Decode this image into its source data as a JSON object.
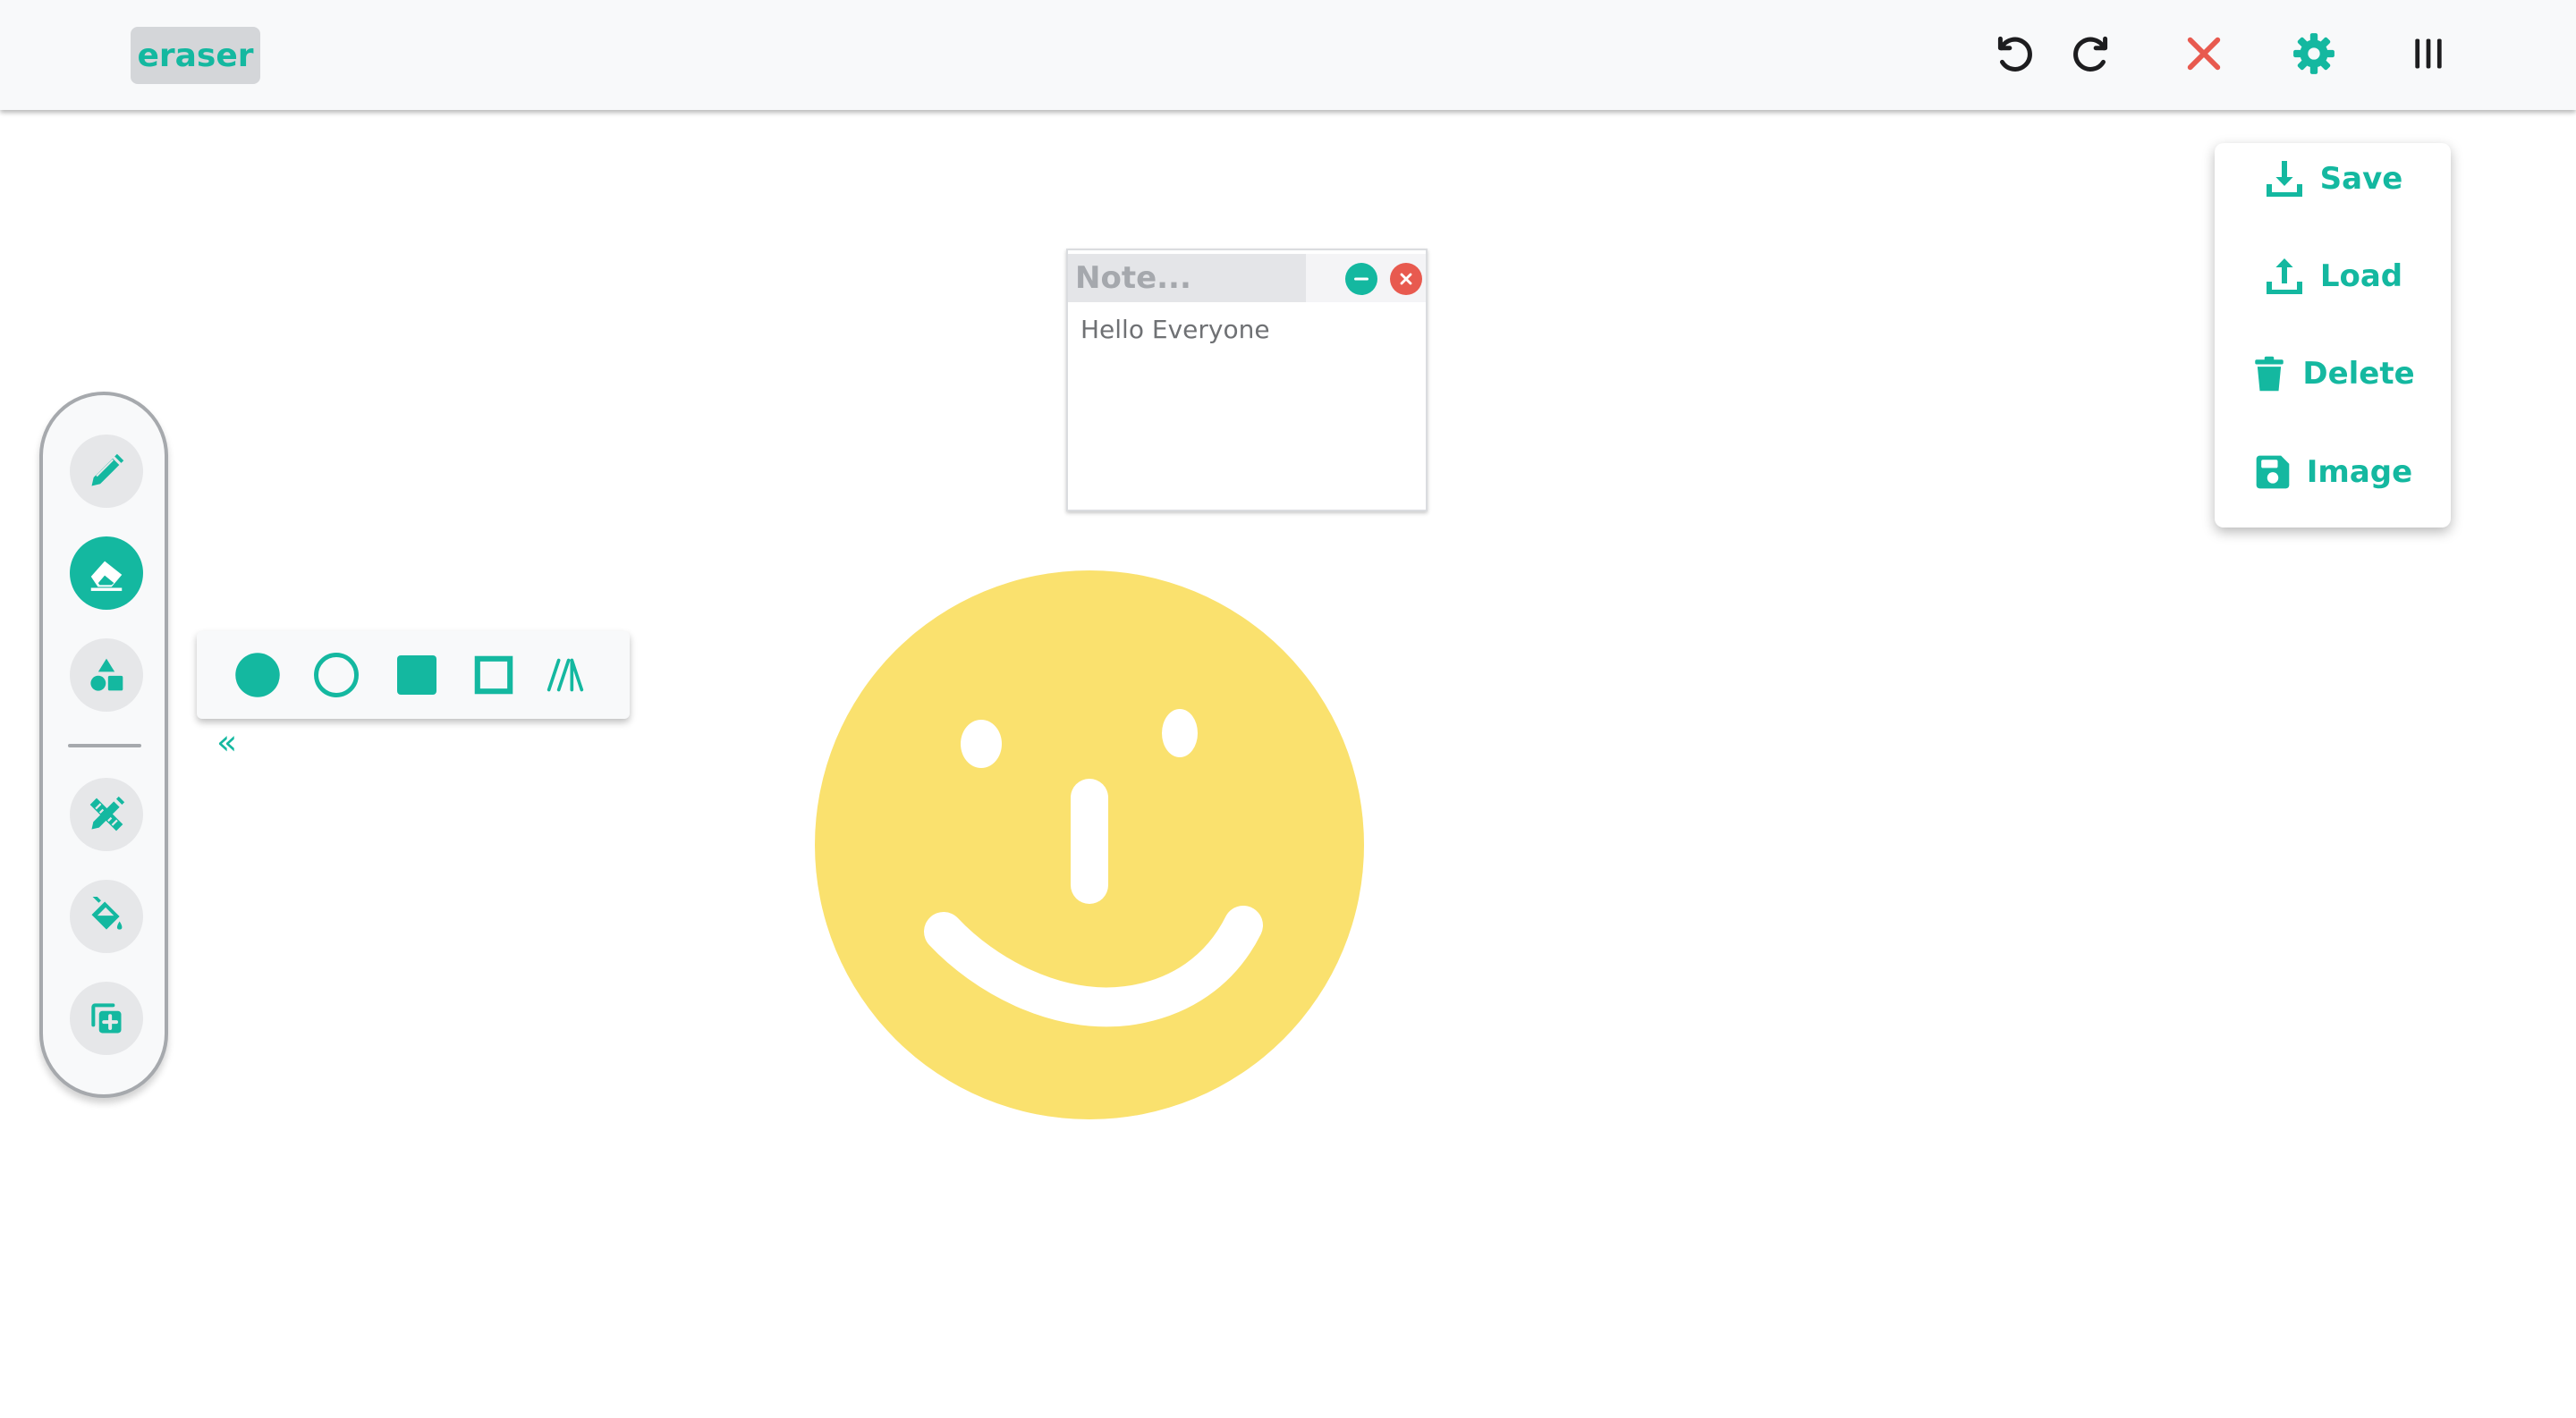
{
  "header": {
    "mode_label": "eraser"
  },
  "toolbar_top": {
    "undo_icon": "undo-icon",
    "redo_icon": "redo-icon",
    "clear_icon": "close-icon",
    "settings_icon": "gear-icon",
    "menu_icon": "vertical-bars-icon"
  },
  "settings_menu": {
    "items": [
      {
        "label": "Save",
        "icon": "download-icon"
      },
      {
        "label": "Load",
        "icon": "upload-icon"
      },
      {
        "label": "Delete",
        "icon": "trash-icon"
      },
      {
        "label": "Image",
        "icon": "floppy-disk-icon"
      }
    ]
  },
  "tools": {
    "items": [
      {
        "name": "pencil",
        "icon": "pencil-icon",
        "active": false
      },
      {
        "name": "eraser",
        "icon": "eraser-icon",
        "active": true
      },
      {
        "name": "shapes",
        "icon": "shapes-icon",
        "active": false
      },
      {
        "name": "pencil-ruler",
        "icon": "pencil-ruler-icon",
        "active": false
      },
      {
        "name": "fill",
        "icon": "fill-bucket-icon",
        "active": false
      },
      {
        "name": "add-layer",
        "icon": "add-copy-icon",
        "active": false
      }
    ]
  },
  "shape_options": {
    "items": [
      "filled-circle",
      "outline-circle",
      "filled-square",
      "outline-square",
      "hatch-pattern"
    ],
    "collapse_glyph": "«"
  },
  "note": {
    "title_placeholder": "Note...",
    "body": "Hello Everyone"
  },
  "colors": {
    "accent": "#14b8a0",
    "danger": "#e85a4f",
    "drawing_fill": "#fae16e",
    "background": "#ffffff"
  }
}
